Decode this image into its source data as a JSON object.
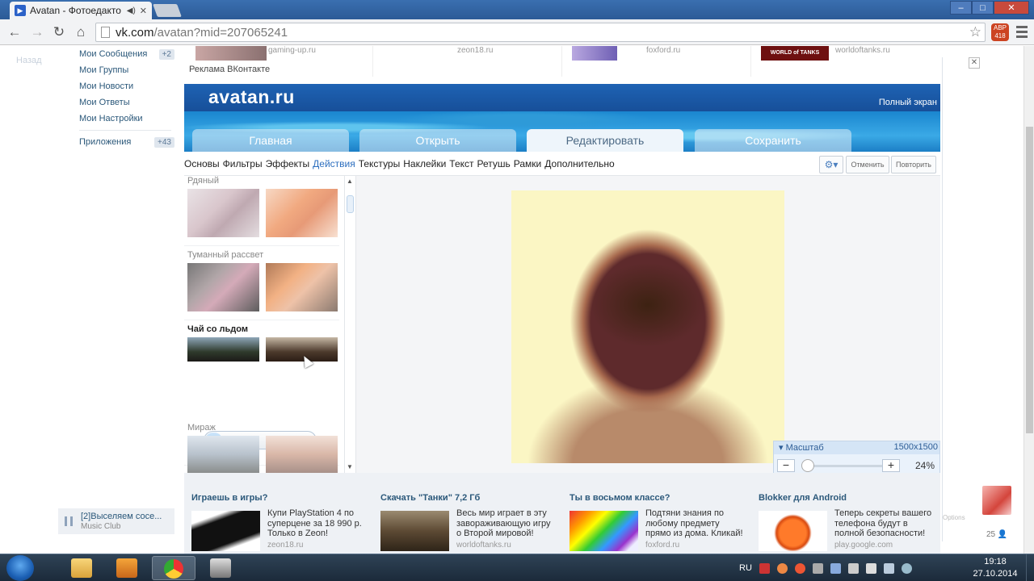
{
  "browser": {
    "tab_title": "Avatan - Фотоедакто",
    "url_host": "vk.com",
    "url_path": "/avatan?mid=207065241",
    "abp_label": "ABP",
    "abp_count": "418"
  },
  "vk": {
    "back_label": "Назад",
    "menu": [
      {
        "label": "Мои Сообщения",
        "count": "+2"
      },
      {
        "label": "Мои Группы",
        "count": ""
      },
      {
        "label": "Мои Новости",
        "count": ""
      },
      {
        "label": "Мои Ответы",
        "count": ""
      },
      {
        "label": "Мои Настройки",
        "count": ""
      },
      {
        "label": "Приложения",
        "count": "+43"
      }
    ],
    "ads_label": "Реклама ВКонтакте",
    "top_ads": [
      {
        "domain": "gaming-up.ru"
      },
      {
        "domain": "zeon18.ru"
      },
      {
        "domain": "foxford.ru"
      },
      {
        "domain": "worldoftanks.ru",
        "logo": "WORLD of TANKS"
      }
    ],
    "player": {
      "title": "[2]Выселяем сосе...",
      "subtitle": "Music Club"
    },
    "right_count": "25",
    "right_options": "Options"
  },
  "app": {
    "logo": "avatan.ru",
    "fullscreen": "Полный экран",
    "main_tabs": [
      "Главная",
      "Открыть",
      "Редактировать",
      "Сохранить"
    ],
    "active_main_tab": "Редактировать",
    "sub_tabs": [
      "Основы",
      "Фильтры",
      "Эффекты",
      "Действия",
      "Текстуры",
      "Наклейки",
      "Текст",
      "Ретушь",
      "Рамки",
      "Дополнительно"
    ],
    "active_sub_tab": "Действия",
    "gear_icon": "gear-icon",
    "undo_label": "Отменить",
    "redo_label": "Повторить",
    "filters": [
      {
        "title": "Рдяный"
      },
      {
        "title": "Туманный рассвет"
      },
      {
        "title": "Чай со льдом"
      },
      {
        "title": "Мираж"
      }
    ],
    "active_filter": "Чай со льдом",
    "progress": 0.15,
    "zoom": {
      "label": "Масштаб",
      "size": "1500x1500",
      "percent": "24%"
    }
  },
  "bottom_ads": [
    {
      "title": "Играешь в игры?",
      "text": "Купи PlayStation 4 по суперцене за 18 990 р. Только в Zeon!",
      "domain": "zeon18.ru"
    },
    {
      "title": "Скачать \"Танки\" 7,2 Гб",
      "text": "Весь мир играет в эту завораживающую игру о Второй мировой!",
      "domain": "worldoftanks.ru"
    },
    {
      "title": "Ты в восьмом классе?",
      "text": "Подтяни знания по любому предмету прямо из дома. Кликай!",
      "domain": "foxford.ru"
    },
    {
      "title": "Blokker для Android",
      "text": "Теперь секреты вашего телефона будут в полной безопасности!",
      "domain": "play.google.com"
    }
  ],
  "taskbar": {
    "lang": "RU",
    "time": "19:18",
    "date": "27.10.2014",
    "pinned": [
      "explorer-icon",
      "media-player-icon",
      "chrome-icon",
      "app-icon"
    ]
  }
}
